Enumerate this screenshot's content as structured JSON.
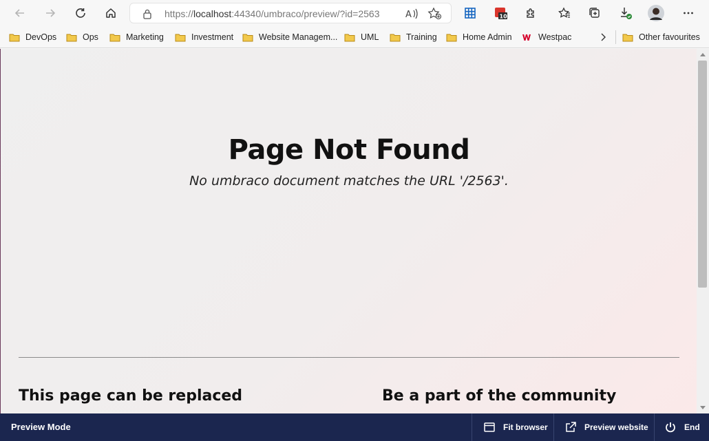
{
  "browser": {
    "url_scheme": "https://",
    "url_host": "localhost",
    "url_rest": ":44340/umbraco/preview/?id=2563",
    "calendar_badge": "10",
    "icons": [
      "back-icon",
      "forward-icon",
      "refresh-icon",
      "home-icon",
      "lock-icon",
      "read-aloud-icon",
      "favorite-add-icon",
      "apps-grid-icon",
      "calendar-icon",
      "extensions-icon",
      "favorites-icon",
      "collections-icon",
      "downloads-icon",
      "avatar",
      "more-icon"
    ]
  },
  "bookmarks": [
    {
      "label": "DevOps"
    },
    {
      "label": "Ops"
    },
    {
      "label": "Marketing"
    },
    {
      "label": "Investment"
    },
    {
      "label": "Website Managem..."
    },
    {
      "label": "UML"
    },
    {
      "label": "Training"
    },
    {
      "label": "Home Admin"
    },
    {
      "label": "Westpac"
    }
  ],
  "other_favourites": "Other favourites",
  "page": {
    "title": "Page Not Found",
    "subtitle": "No umbraco document matches the URL '/2563'.",
    "section_left": "This page can be replaced",
    "section_right": "Be a part of the community"
  },
  "preview_bar": {
    "label": "Preview Mode",
    "fit_browser": "Fit browser",
    "preview_website": "Preview website",
    "end": "End"
  },
  "colors": {
    "preview_bar_bg": "#1b264f",
    "folder": "#f2c94c",
    "westpac": "#d5002b",
    "apps_blue": "#1565c0"
  }
}
